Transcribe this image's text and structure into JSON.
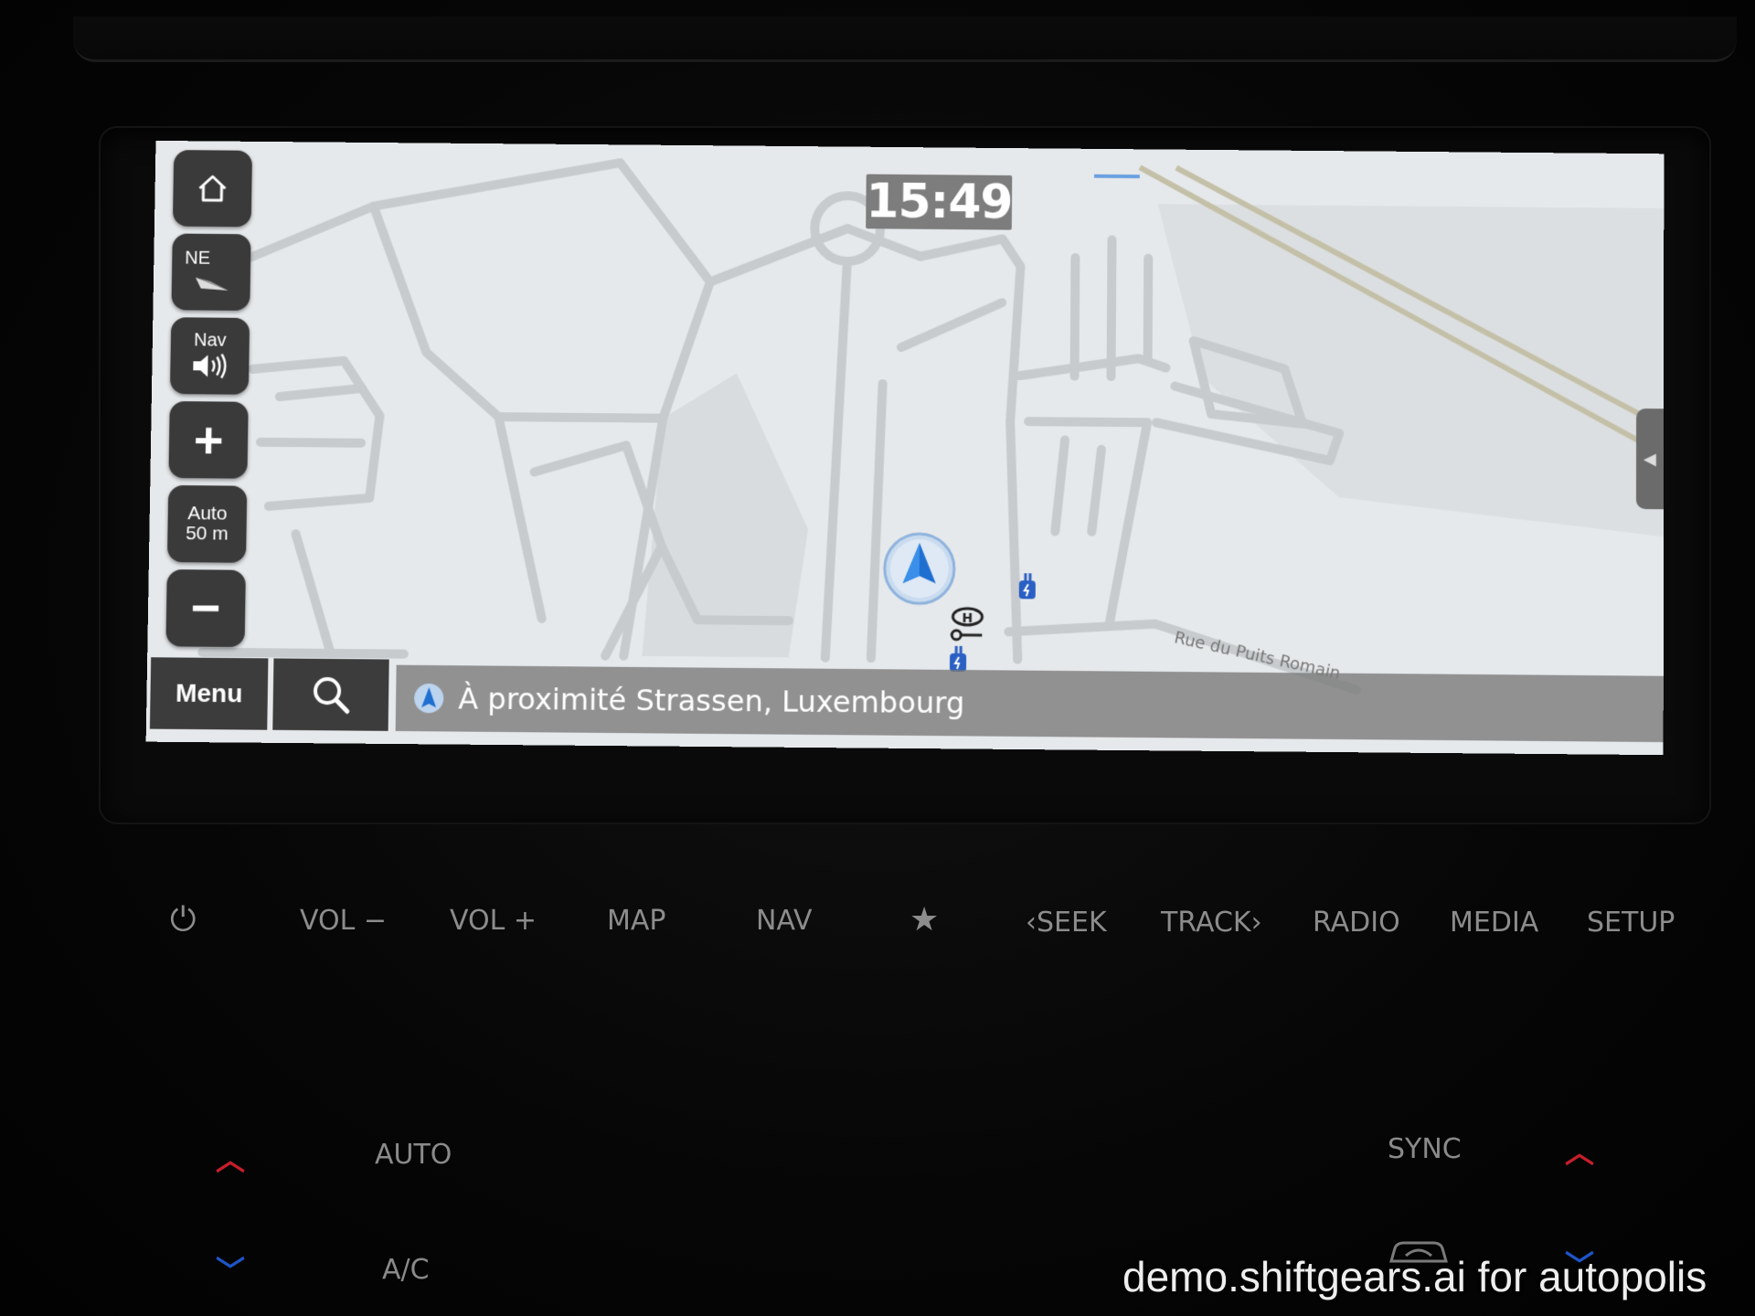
{
  "screen": {
    "clock": "15:49",
    "side_buttons": {
      "home": "",
      "compass": "NE",
      "nav_voice": "Nav",
      "zoom_in": "+",
      "scale_line1": "Auto",
      "scale_line2": "50 m",
      "zoom_out": "−"
    },
    "bottom_bar": {
      "menu": "Menu",
      "location": "À proximité Strassen, Luxembourg"
    },
    "map": {
      "street_label": "Rue du Puits Romain",
      "icons": [
        "ev-charging-icon",
        "ev-charging-icon",
        "hyundai-service-icon"
      ]
    }
  },
  "hardware": {
    "buttons": [
      "VOL −",
      "VOL +",
      "MAP",
      "NAV",
      "★",
      "‹SEEK",
      "TRACK›",
      "RADIO",
      "MEDIA",
      "SETUP"
    ],
    "power_icon": "⏻",
    "climate": {
      "auto": "AUTO",
      "ac": "A/C",
      "sync": "SYNC"
    }
  },
  "watermark": "demo.shiftgears.ai for autopolis",
  "colors": {
    "map_bg": "#e9ecee",
    "road": "#c9cdd0",
    "button_dark": "#3a3a3a",
    "location_bar": "#787878",
    "accent_blue": "#2a78d4",
    "climate_up": "#c81e2a",
    "climate_down": "#1e55c8"
  }
}
